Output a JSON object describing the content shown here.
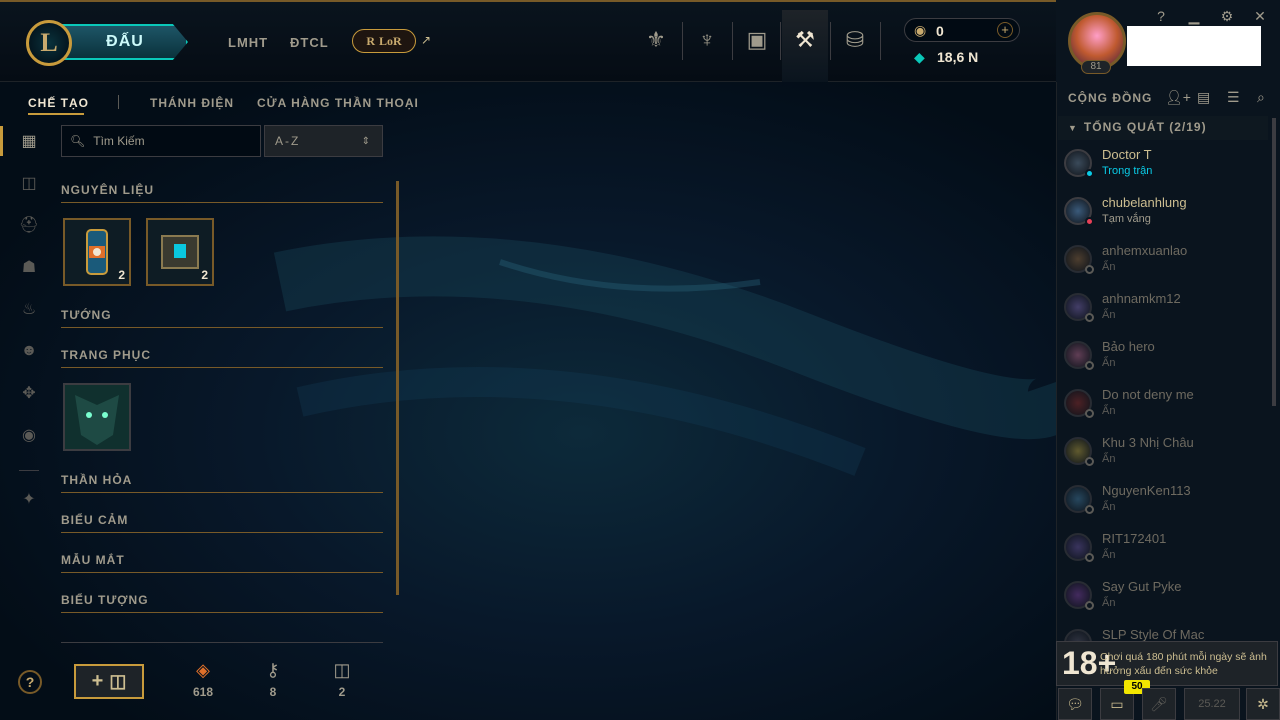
{
  "topbar": {
    "play_label": "ĐẤU",
    "nav": [
      "LMHT",
      "ĐTCL"
    ],
    "lor_label": "LoR",
    "rp_value": "0",
    "be_value": "18,6 N",
    "icons": [
      "trophy-icon",
      "rank-icon",
      "store-bag-icon",
      "crafting-icon",
      "currency-icon"
    ]
  },
  "profile": {
    "level": "81"
  },
  "window_controls": {
    "help": "?",
    "minimize": "▁",
    "settings": "⚙",
    "close": "✕"
  },
  "subtabs": [
    "CHẾ TẠO",
    "THÁNH ĐIỆN",
    "CỬA HÀNG THẦN THOẠI"
  ],
  "search": {
    "placeholder": "Tìm Kiếm"
  },
  "sort": {
    "value": "A-Z"
  },
  "categories": [
    {
      "label": "NGUYÊN LIỆU",
      "items": [
        {
          "name": "chest-capsule",
          "count": "2"
        },
        {
          "name": "hextech-chest",
          "count": "2"
        }
      ]
    },
    {
      "label": "TƯỚNG"
    },
    {
      "label": "TRANG PHỤC"
    },
    {
      "label": "THẦN HỎA"
    },
    {
      "label": "BIỂU CẢM"
    },
    {
      "label": "MẪU MẮT"
    },
    {
      "label": "BIỂU TƯỢNG"
    }
  ],
  "footer": {
    "help": "?",
    "orange_essence": "618",
    "keys": "8",
    "chests": "2"
  },
  "social": {
    "title": "CỘNG ĐỒNG",
    "group": "TỔNG QUÁT (2/19)",
    "friends": [
      {
        "name": "Doctor T",
        "status": "Trong trận",
        "state": "ingame"
      },
      {
        "name": "chubelanhlung",
        "status": "Tạm vắng",
        "state": "away"
      },
      {
        "name": "anhemxuanlao",
        "status": "Ẩn",
        "state": "offline"
      },
      {
        "name": "anhnamkm12",
        "status": "Ẩn",
        "state": "offline"
      },
      {
        "name": "Bảo hero",
        "status": "Ẩn",
        "state": "offline"
      },
      {
        "name": "Do not deny me",
        "status": "Ẩn",
        "state": "offline"
      },
      {
        "name": "Khu 3 Nhị Châu",
        "status": "Ẩn",
        "state": "offline"
      },
      {
        "name": "NguyenKen113",
        "status": "Ẩn",
        "state": "offline"
      },
      {
        "name": "RIT172401",
        "status": "Ẩn",
        "state": "offline"
      },
      {
        "name": "Say Gut Pyke",
        "status": "Ẩn",
        "state": "offline"
      },
      {
        "name": "SLP Style Of Mac",
        "status": "",
        "state": "offline"
      }
    ],
    "warning_age": "18+",
    "warning_text": "Chơi quá 180 phút mỗi ngày sẽ ảnh hưởng xấu đến sức khỏe",
    "badge": "50",
    "version": "25.22"
  },
  "colors": {
    "gold": "#c89b3c",
    "teal": "#0ac8b9",
    "ingame": "#0acbe6",
    "away": "#e84057",
    "offline": "#5b5a56"
  }
}
